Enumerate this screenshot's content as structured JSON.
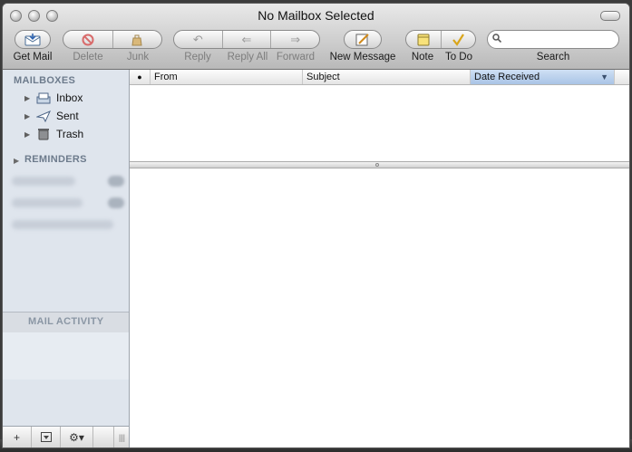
{
  "window": {
    "title": "No Mailbox Selected"
  },
  "toolbar": {
    "get_mail": "Get Mail",
    "delete": "Delete",
    "junk": "Junk",
    "reply": "Reply",
    "reply_all": "Reply All",
    "forward": "Forward",
    "new_message": "New Message",
    "note": "Note",
    "todo": "To Do",
    "search_label": "Search",
    "search_value": ""
  },
  "sidebar": {
    "mailboxes_title": "MAILBOXES",
    "items": [
      {
        "label": "Inbox",
        "icon": "inbox-tray-icon"
      },
      {
        "label": "Sent",
        "icon": "paper-plane-icon"
      },
      {
        "label": "Trash",
        "icon": "trash-can-icon"
      }
    ],
    "reminders_title": "REMINDERS",
    "mail_activity_title": "MAIL ACTIVITY"
  },
  "list": {
    "columns": [
      "From",
      "Subject",
      "Date Received"
    ],
    "sort_column": "Date Received"
  },
  "colors": {
    "sidebar_bg": "#dfe5ed",
    "sorted_header": "#b6cde9"
  }
}
